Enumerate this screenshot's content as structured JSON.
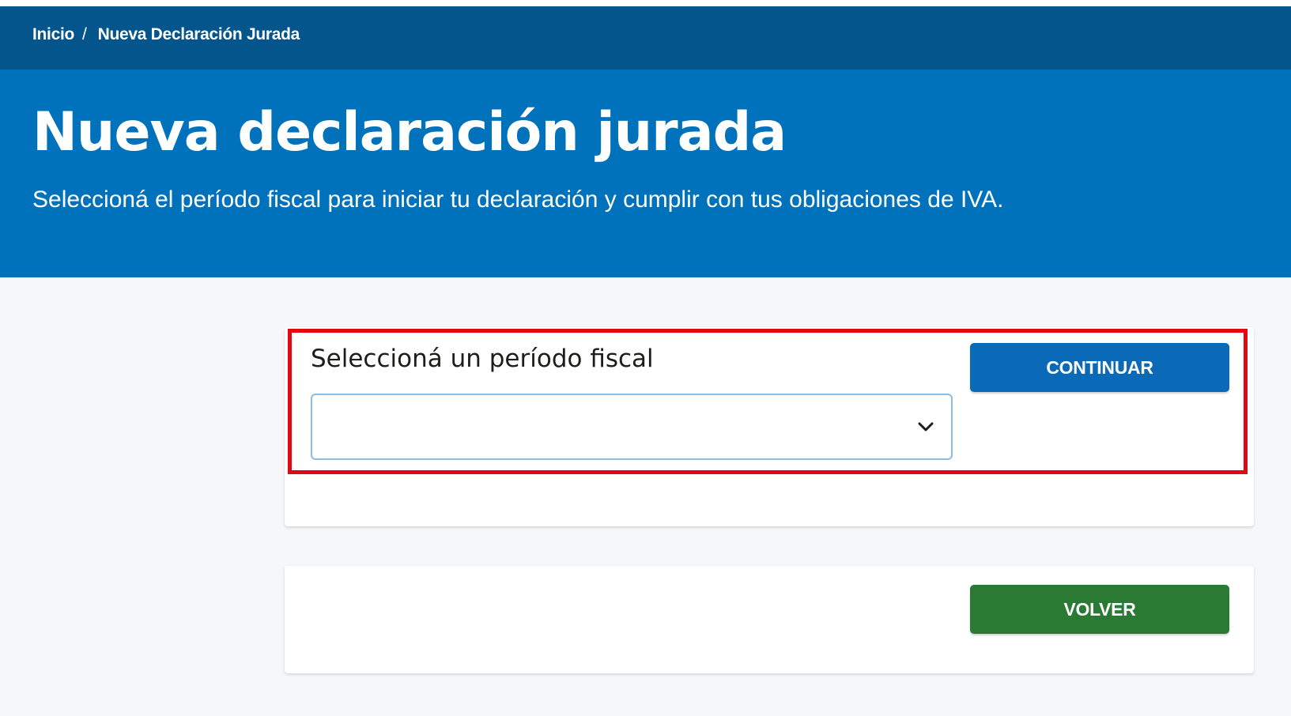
{
  "breadcrumb": {
    "home": "Inicio",
    "separator": "/",
    "current": "Nueva Declaración Jurada"
  },
  "hero": {
    "title": "Nueva declaración jurada",
    "subtitle": "Seleccioná el período fiscal para iniciar tu declaración y cumplir con tus obligaciones de IVA."
  },
  "period_form": {
    "label": "Seleccioná un período fiscal",
    "selected_value": "",
    "chevron_icon": "chevron-down-icon",
    "continue_label": "CONTINUAR"
  },
  "footer_actions": {
    "back_label": "VOLVER"
  },
  "colors": {
    "breadcrumb_bar": "#03558c",
    "hero_background": "#0072bb",
    "continue_button": "#0a6ab8",
    "back_button": "#2b7a34",
    "highlight_border": "#e30613"
  }
}
